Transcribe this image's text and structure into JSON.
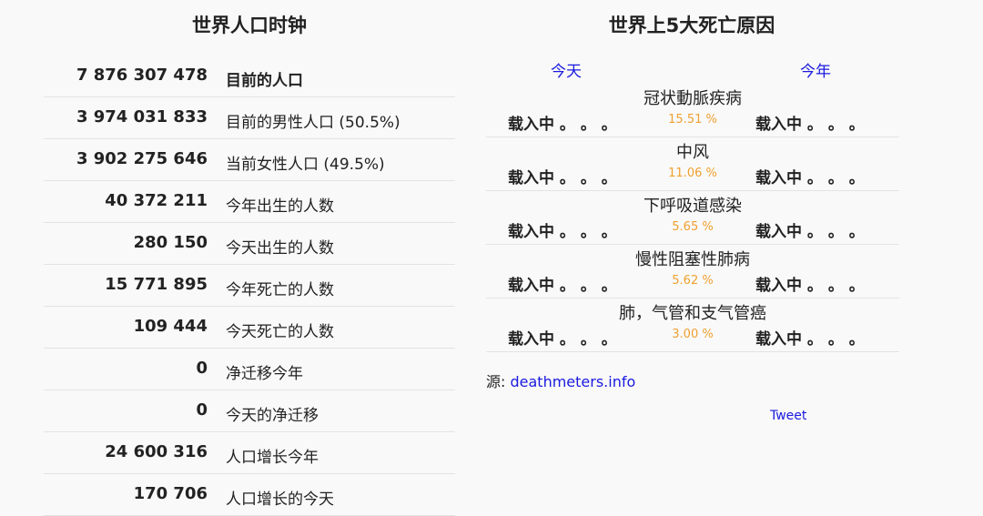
{
  "population_clock": {
    "title": "世界人口时钟",
    "rows": [
      {
        "value": "7 876 307 478",
        "label": "目前的人口"
      },
      {
        "value": "3 974 031 833",
        "label": "目前的男性人口 (50.5%)"
      },
      {
        "value": "3 902 275 646",
        "label": "当前女性人口 (49.5%)"
      },
      {
        "value": "40 372 211",
        "label": "今年出生的人数"
      },
      {
        "value": "280 150",
        "label": "今天出生的人数"
      },
      {
        "value": "15 771 895",
        "label": "今年死亡的人数"
      },
      {
        "value": "109 444",
        "label": "今天死亡的人数"
      },
      {
        "value": "0",
        "label": "净迁移今年"
      },
      {
        "value": "0",
        "label": "今天的净迁移"
      },
      {
        "value": "24 600 316",
        "label": "人口增长今年"
      },
      {
        "value": "170 706",
        "label": "人口增长的今天"
      }
    ]
  },
  "death_causes": {
    "title": "世界上5大死亡原因",
    "col_today": "今天",
    "col_year": "今年",
    "loading_text": "载入中 。 。 。",
    "causes": [
      {
        "name": "冠状動脈疾病",
        "percent": "15.51 %"
      },
      {
        "name": "中风",
        "percent": "11.06 %"
      },
      {
        "name": "下呼吸道感染",
        "percent": "5.65 %"
      },
      {
        "name": "慢性阻塞性肺病",
        "percent": "5.62 %"
      },
      {
        "name": "肺，气管和支气管癌",
        "percent": "3.00 %"
      }
    ]
  },
  "source": {
    "prefix": "源: ",
    "link": "deathmeters.info"
  },
  "tweet_label": "Tweet"
}
